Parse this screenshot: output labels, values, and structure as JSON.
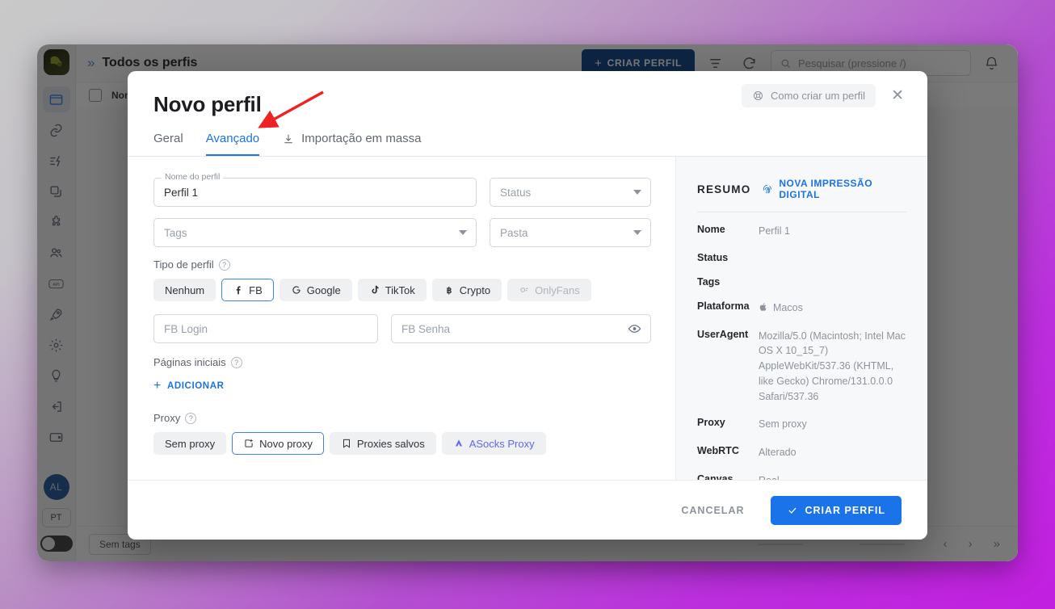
{
  "app": {
    "breadcrumb": "Todos os perfis",
    "create_button": "CRIAR PERFIL",
    "search_placeholder": "Pesquisar (pressione /)",
    "table_column": "Nome",
    "tag_chip": "Sem tags",
    "sidebar_avatar": "AL",
    "sidebar_lang": "PT",
    "sidebar_icons": [
      "browser-icon",
      "link-icon",
      "automation-icon",
      "copy-icon",
      "puzzle-icon",
      "team-icon",
      "api-icon",
      "rocket-icon",
      "gear-icon",
      "lightbulb-icon",
      "logout-icon",
      "wallet-icon"
    ]
  },
  "modal": {
    "title": "Novo perfil",
    "help_label": "Como criar um perfil",
    "tabs": [
      {
        "label": "Geral",
        "active": false,
        "icon": null
      },
      {
        "label": "Avançado",
        "active": true,
        "icon": null
      },
      {
        "label": "Importação em massa",
        "active": false,
        "icon": "download-icon"
      }
    ],
    "form": {
      "profile_name_label": "Nome do perfil",
      "profile_name_value": "Perfil 1",
      "status_placeholder": "Status",
      "tags_placeholder": "Tags",
      "folder_placeholder": "Pasta",
      "profile_type_label": "Tipo de perfil",
      "profile_types": [
        {
          "label": "Nenhum",
          "icon": null,
          "selected": false,
          "disabled": false
        },
        {
          "label": "FB",
          "icon": "facebook-icon",
          "selected": true,
          "disabled": false
        },
        {
          "label": "Google",
          "icon": "google-icon",
          "selected": false,
          "disabled": false
        },
        {
          "label": "TikTok",
          "icon": "tiktok-icon",
          "selected": false,
          "disabled": false
        },
        {
          "label": "Crypto",
          "icon": "bitcoin-icon",
          "selected": false,
          "disabled": false
        },
        {
          "label": "OnlyFans",
          "icon": "onlyfans-icon",
          "selected": false,
          "disabled": true
        }
      ],
      "fb_login_placeholder": "FB Login",
      "fb_password_placeholder": "FB Senha",
      "start_pages_label": "Páginas iniciais",
      "add_button": "ADICIONAR",
      "proxy_label": "Proxy",
      "proxy_options": [
        {
          "label": "Sem proxy",
          "icon": null,
          "selected": false
        },
        {
          "label": "Novo proxy",
          "icon": "new-proxy-icon",
          "selected": true
        },
        {
          "label": "Proxies salvos",
          "icon": "bookmark-icon",
          "selected": false
        },
        {
          "label": "ASocks Proxy",
          "icon": "asocks-icon",
          "selected": false
        }
      ]
    },
    "summary": {
      "title": "RESUMO",
      "fingerprint_button": "NOVA IMPRESSÃO DIGITAL",
      "rows": [
        {
          "key": "Nome",
          "value": "Perfil 1",
          "icon": null
        },
        {
          "key": "Status",
          "value": "",
          "icon": null
        },
        {
          "key": "Tags",
          "value": "",
          "icon": null
        },
        {
          "key": "Plataforma",
          "value": "Macos",
          "icon": "apple-icon"
        },
        {
          "key": "UserAgent",
          "value": "Mozilla/5.0 (Macintosh; Intel Mac OS X 10_15_7) AppleWebKit/537.36 (KHTML, like Gecko) Chrome/131.0.0.0 Safari/537.36",
          "icon": null
        },
        {
          "key": "Proxy",
          "value": "Sem proxy",
          "icon": null
        },
        {
          "key": "WebRTC",
          "value": "Alterado",
          "icon": null
        },
        {
          "key": "Canvas",
          "value": "Real",
          "icon": null
        }
      ]
    },
    "footer": {
      "cancel": "CANCELAR",
      "submit": "CRIAR PERFIL"
    }
  },
  "colors": {
    "accent": "#1a73e8",
    "create_button_bg": "#1d4e8f",
    "annotation_arrow": "#ee2222",
    "asocks": "#6366f1"
  }
}
